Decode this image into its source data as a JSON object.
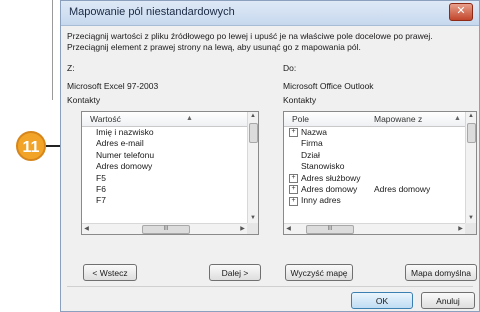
{
  "callout": {
    "number": "11"
  },
  "dialog": {
    "title": "Mapowanie pól niestandardowych",
    "close_symbol": "✕",
    "instruction": "Przeciągnij wartości z pliku źródłowego po lewej i upuść je na właściwe pole docelowe po prawej. Przeciągnij element z prawej strony na lewą, aby usunąć go z mapowania pól."
  },
  "source": {
    "label": "Z:",
    "app": "Microsoft Excel 97-2003",
    "folder": "Kontakty",
    "column_header": "Wartość",
    "items": [
      "Imię i nazwisko",
      "Adres e-mail",
      "Numer telefonu",
      "Adres domowy",
      "F5",
      "F6",
      "F7"
    ],
    "hscroll_thumb": "III",
    "prev_button": "< Wstecz",
    "next_button": "Dalej >"
  },
  "target": {
    "label": "Do:",
    "app": "Microsoft Office Outlook",
    "folder": "Kontakty",
    "column_field": "Pole",
    "column_mapped": "Mapowane z",
    "items": [
      {
        "name": "Nazwa",
        "expander": "⊞",
        "mapped": ""
      },
      {
        "name": "Firma",
        "expander": "",
        "mapped": ""
      },
      {
        "name": "Dział",
        "expander": "",
        "mapped": ""
      },
      {
        "name": "Stanowisko",
        "expander": "",
        "mapped": ""
      },
      {
        "name": "Adres służbowy",
        "expander": "⊞",
        "mapped": ""
      },
      {
        "name": "Adres domowy",
        "expander": "⊞",
        "mapped": "Adres domowy"
      },
      {
        "name": "Inny adres",
        "expander": "⊞",
        "mapped": ""
      }
    ],
    "hscroll_thumb": "III",
    "clear_button": "Wyczyść mapę",
    "default_button": "Mapa domyślna"
  },
  "footer": {
    "ok_button": "OK",
    "cancel_button": "Anuluj"
  }
}
